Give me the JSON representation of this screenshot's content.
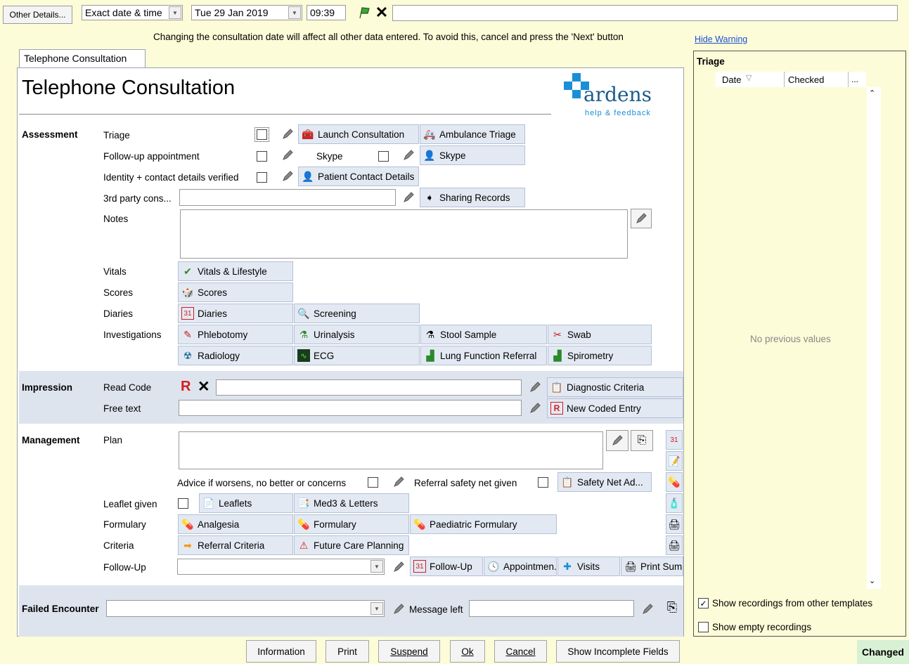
{
  "topbar": {
    "other_details": "Other Details...",
    "date_mode": "Exact date & time",
    "date": "Tue 29 Jan 2019",
    "time": "09:39",
    "warning": "Changing the consultation date will affect all other data entered. To avoid this, cancel and press the 'Next' button",
    "hide_warning": "Hide Warning"
  },
  "tab": {
    "label": "Telephone Consultation"
  },
  "form": {
    "title": "Telephone Consultation",
    "logo_text": "ardens",
    "logo_sub": "help & feedback"
  },
  "assessment": {
    "section": "Assessment",
    "triage": "Triage",
    "followup_appt": "Follow-up appointment",
    "identity": "Identity + contact details verified",
    "third_party": "3rd party cons...",
    "notes": "Notes",
    "vitals": "Vitals",
    "scores": "Scores",
    "diaries": "Diaries",
    "investigations": "Investigations",
    "skype_label": "Skype",
    "buttons": {
      "launch_consultation": "Launch Consultation",
      "ambulance_triage": "Ambulance Triage",
      "skype": "Skype",
      "patient_contact": "Patient Contact Details",
      "sharing_records": "Sharing Records",
      "vitals_lifestyle": "Vitals & Lifestyle",
      "scores": "Scores",
      "diaries": "Diaries",
      "screening": "Screening",
      "phlebotomy": "Phlebotomy",
      "urinalysis": "Urinalysis",
      "stool_sample": "Stool Sample",
      "swab": "Swab",
      "radiology": "Radiology",
      "ecg": "ECG",
      "lung_function": "Lung Function Referral",
      "spirometry": "Spirometry"
    }
  },
  "impression": {
    "section": "Impression",
    "read_code": "Read Code",
    "free_text": "Free text",
    "diagnostic_criteria": "Diagnostic Criteria",
    "new_coded_entry": "New Coded Entry"
  },
  "management": {
    "section": "Management",
    "plan": "Plan",
    "advice": "Advice if worsens, no better or concerns",
    "referral_safety": "Referral safety net given",
    "safety_net": "Safety Net Ad...",
    "leaflet_given": "Leaflet given",
    "formulary_label": "Formulary",
    "criteria": "Criteria",
    "followup": "Follow-Up",
    "buttons": {
      "leaflets": "Leaflets",
      "med3": "Med3 & Letters",
      "analgesia": "Analgesia",
      "formulary": "Formulary",
      "paediatric": "Paediatric Formulary",
      "referral_criteria": "Referral Criteria",
      "future_care": "Future Care Planning",
      "followup_btn": "Follow-Up",
      "appointment": "Appointmen...",
      "visits": "Visits",
      "print_summary": "Print Summ"
    }
  },
  "failed": {
    "section": "Failed Encounter",
    "message_left": "Message left"
  },
  "triage_panel": {
    "title": "Triage",
    "col_date": "Date",
    "col_checked": "Checked",
    "col_more": "...",
    "empty": "No previous values",
    "show_other": "Show recordings from other templates",
    "show_empty": "Show empty recordings",
    "show_other_checked": true,
    "show_empty_checked": false
  },
  "bottom": {
    "information": "Information",
    "print": "Print",
    "suspend": "Suspend",
    "ok": "Ok",
    "cancel": "Cancel",
    "incomplete": "Show Incomplete Fields",
    "status": "Changed"
  },
  "colors": {
    "background": "#fdfcd8",
    "button_blue": "#e3e9f3",
    "band": "#dee4ee",
    "link": "#1a4fd6",
    "logo_blue": "#1a8fd6",
    "status_bg": "#d8f0d4"
  }
}
